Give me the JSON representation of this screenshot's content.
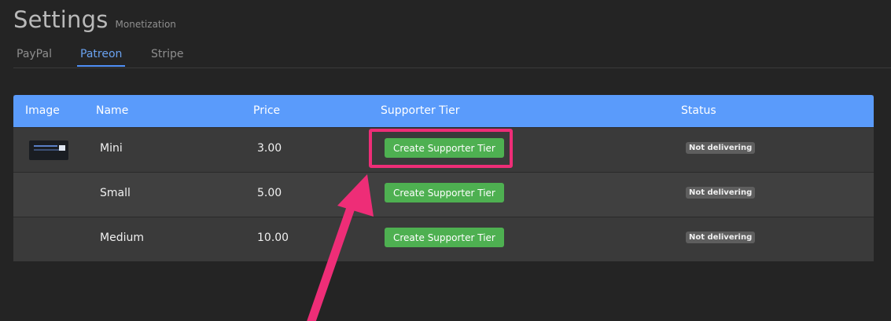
{
  "header": {
    "title": "Settings",
    "subtitle": "Monetization"
  },
  "tabs": [
    {
      "label": "PayPal",
      "active": false
    },
    {
      "label": "Patreon",
      "active": true
    },
    {
      "label": "Stripe",
      "active": false
    }
  ],
  "table": {
    "columns": [
      "Image",
      "Name",
      "Price",
      "Supporter Tier",
      "Status"
    ],
    "rows": [
      {
        "name": "Mini",
        "price": "3.00",
        "tier_button": "Create Supporter Tier",
        "status": "Not delivering",
        "has_image": true
      },
      {
        "name": "Small",
        "price": "5.00",
        "tier_button": "Create Supporter Tier",
        "status": "Not delivering",
        "has_image": false
      },
      {
        "name": "Medium",
        "price": "10.00",
        "tier_button": "Create Supporter Tier",
        "status": "Not delivering",
        "has_image": false
      }
    ]
  },
  "colors": {
    "accent": "#5a9bfb",
    "button_green": "#4eb051",
    "annotation_pink": "#ee2d77",
    "background": "#242424"
  }
}
